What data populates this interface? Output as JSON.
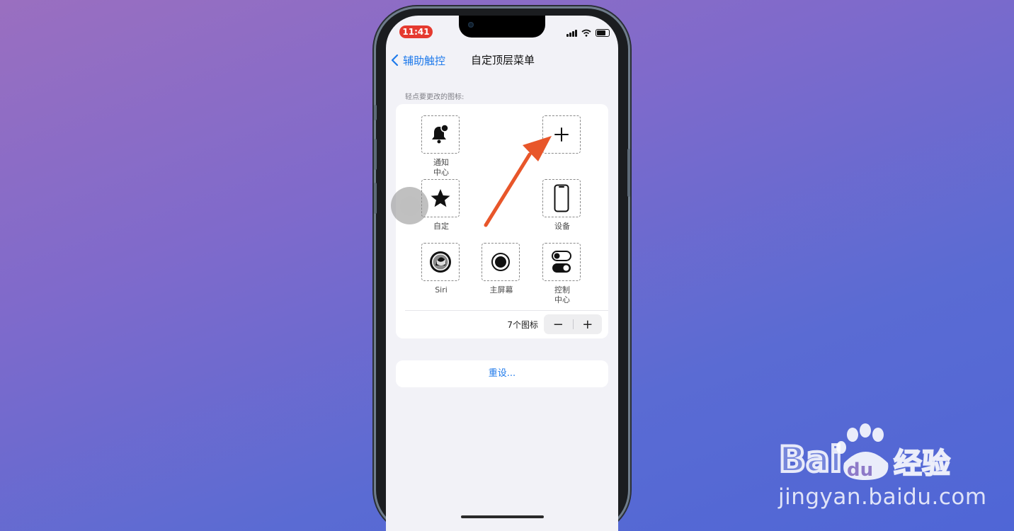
{
  "status_bar": {
    "time": "11:41",
    "time_pill_color": "#e53a2f"
  },
  "nav": {
    "back_label": "辅助触控",
    "title": "自定顶层菜单"
  },
  "section_caption": "轻点要更改的图标:",
  "icons": [
    {
      "label_line1": "通知",
      "label_line2": "中心",
      "icon": "bell-badge-icon"
    },
    {
      "label_line1": "",
      "label_line2": "",
      "icon": "plus-icon"
    },
    {
      "label_line1": "自定",
      "label_line2": "",
      "icon": "star-icon"
    },
    {
      "label_line1": "设备",
      "label_line2": "",
      "icon": "iphone-icon"
    },
    {
      "label_line1": "Siri",
      "label_line2": "",
      "icon": "siri-icon"
    },
    {
      "label_line1": "主屏幕",
      "label_line2": "",
      "icon": "home-button-icon"
    },
    {
      "label_line1": "控制",
      "label_line2": "中心",
      "icon": "toggles-icon"
    }
  ],
  "icon_count": {
    "label": "7个图标",
    "minus": "−",
    "plus": "+"
  },
  "reset_label": "重设...",
  "accent_color": "#1f7aeb",
  "annotation_arrow_color": "#e8562a",
  "watermark": {
    "brand_left": "Bai",
    "brand_paw": "du",
    "brand_right": "经验",
    "url": "jingyan.baidu.com"
  }
}
